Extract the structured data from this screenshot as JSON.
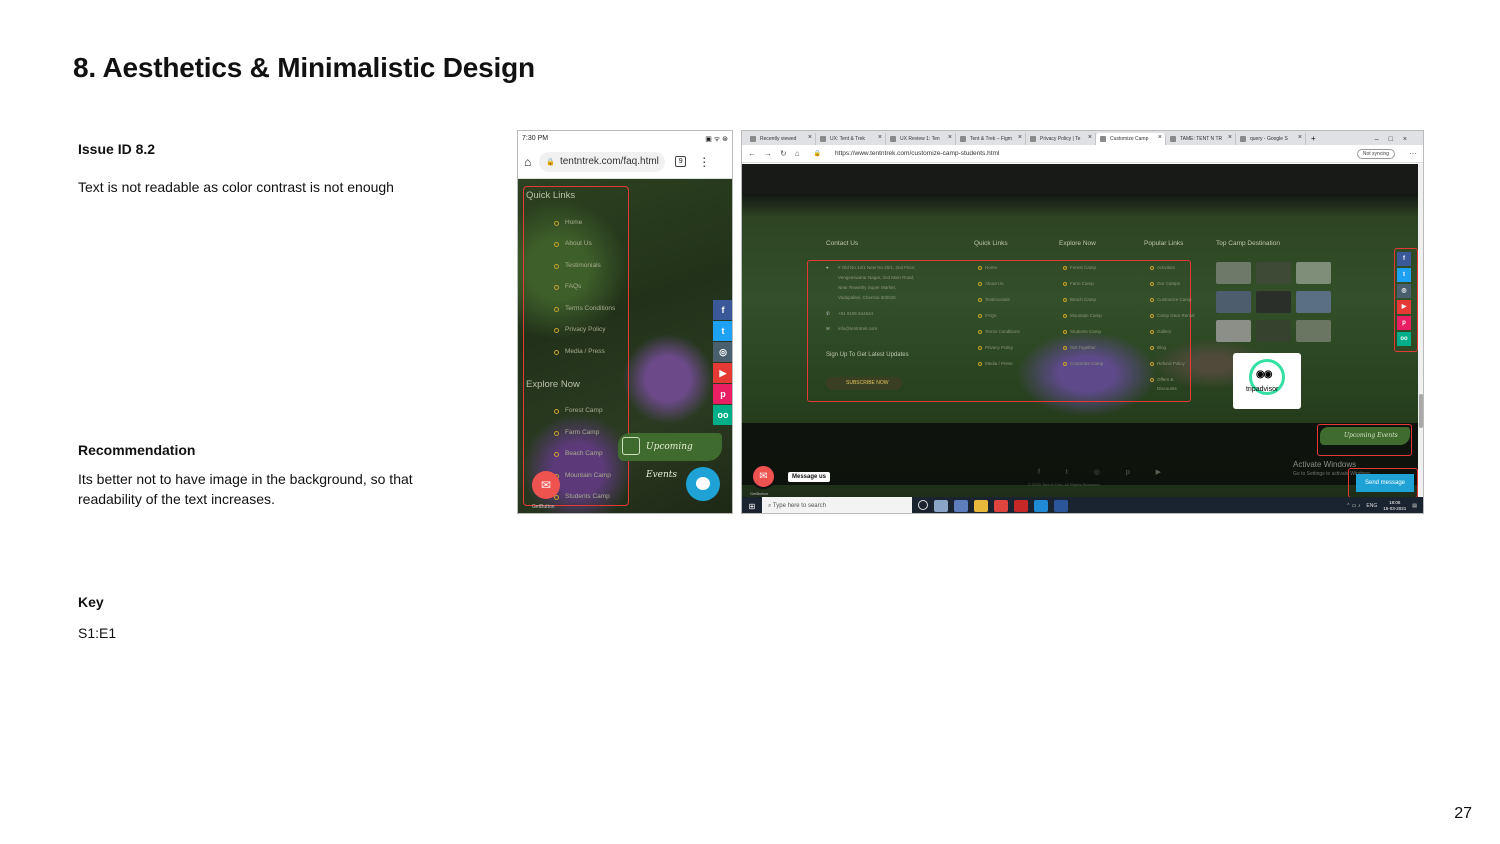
{
  "slide": {
    "title": "8. Aesthetics & Minimalistic Design",
    "page_number": "27"
  },
  "issue": {
    "label": "Issue ID 8.2",
    "text": "Text is not readable as color contrast is not enough"
  },
  "recommendation": {
    "label": "Recommendation",
    "text": "Its better not to have image in the background, so that readability of the text increases."
  },
  "key": {
    "label": "Key",
    "value": "S1:E1"
  },
  "phone": {
    "time": "7:30 PM",
    "status_icons": "▣ ᯤ ⊛",
    "url": "tentntrek.com/faq.html",
    "tab_count": "9",
    "quick_links_title": "Quick Links",
    "quick_links": [
      "Home",
      "About Us",
      "Testimonials",
      "FAQs",
      "Terms Conditions",
      "Privacy Policy",
      "Media / Press"
    ],
    "explore_title": "Explore Now",
    "explore_links": [
      "Forest Camp",
      "Farm Camp",
      "Beach Camp",
      "Mountain Camp",
      "Students Camp"
    ],
    "upcoming_label": "Upcoming Events",
    "getbutton": "GetButton",
    "social": [
      {
        "icon": "facebook-icon",
        "glyph": "f",
        "color": "#3b5998"
      },
      {
        "icon": "twitter-icon",
        "glyph": "t",
        "color": "#1da1f2"
      },
      {
        "icon": "instagram-icon",
        "glyph": "◎",
        "color": "#4a5f6e"
      },
      {
        "icon": "youtube-icon",
        "glyph": "▶",
        "color": "#e53935"
      },
      {
        "icon": "pinterest-icon",
        "glyph": "p",
        "color": "#e91e63"
      },
      {
        "icon": "tripadvisor-icon",
        "glyph": "oo",
        "color": "#00af87"
      }
    ]
  },
  "desktop": {
    "tabs": [
      "Recently viewed",
      "UX: Tent & Trek",
      "UX Review 1: Ten",
      "Tent & Trek – Figm",
      "Privacy Policy | Te",
      "Customize Camp",
      "TAME: TENT N TR",
      "query - Google S"
    ],
    "url": "https://www.tentntrek.com/customize-camp-students.html",
    "sync": "Not syncing",
    "columns": {
      "contact": "Contact Us",
      "quick": "Quick Links",
      "explore": "Explore Now",
      "popular": "Popular Links",
      "top": "Top Camp Destination"
    },
    "contact_lines": [
      "# Old No.14/1 New No.25/1, 2nd Floor,",
      "Vengeeswarar Nagar, 2nd Main Road,",
      "Near Rewethy Super Market,",
      "Vadapalani, Chennai 600026",
      "+91 9195 544544",
      "info@tentntrek.com"
    ],
    "signup": "Sign Up To Get Latest Updates",
    "subscribe": "SUBSCRIBE NOW",
    "quick_links": [
      "Home",
      "About Us",
      "Testimonials",
      "FAQs",
      "Terms Conditions",
      "Privacy Policy",
      "Media / Press"
    ],
    "explore_links": [
      "Forest Camp",
      "Farm Camp",
      "Beach Camp",
      "Mountain Camp",
      "Students Camp",
      "Get Together",
      "Corporate Camp"
    ],
    "popular_links": [
      "Activities",
      "Our Camps",
      "Customize Camp",
      "Camp Gear Rental",
      "Gallery",
      "Blog",
      "Refund Policy",
      "Offers &",
      "Discounts"
    ],
    "tripadvisor": "tripadvisor",
    "upcoming_label": "Upcoming Events",
    "message_us": "Message us",
    "getbutton": "GetButton",
    "activate_title": "Activate Windows",
    "activate_sub": "Go to Settings to activate Windows.",
    "send_message": "Send message",
    "footer_copy": "© 2020 Tent N Trek. All Rights Reserved",
    "taskbar_search": "Type here to search",
    "tray_lang": "ENG",
    "clock_time": "18:06",
    "clock_date": "15-03-2021"
  }
}
